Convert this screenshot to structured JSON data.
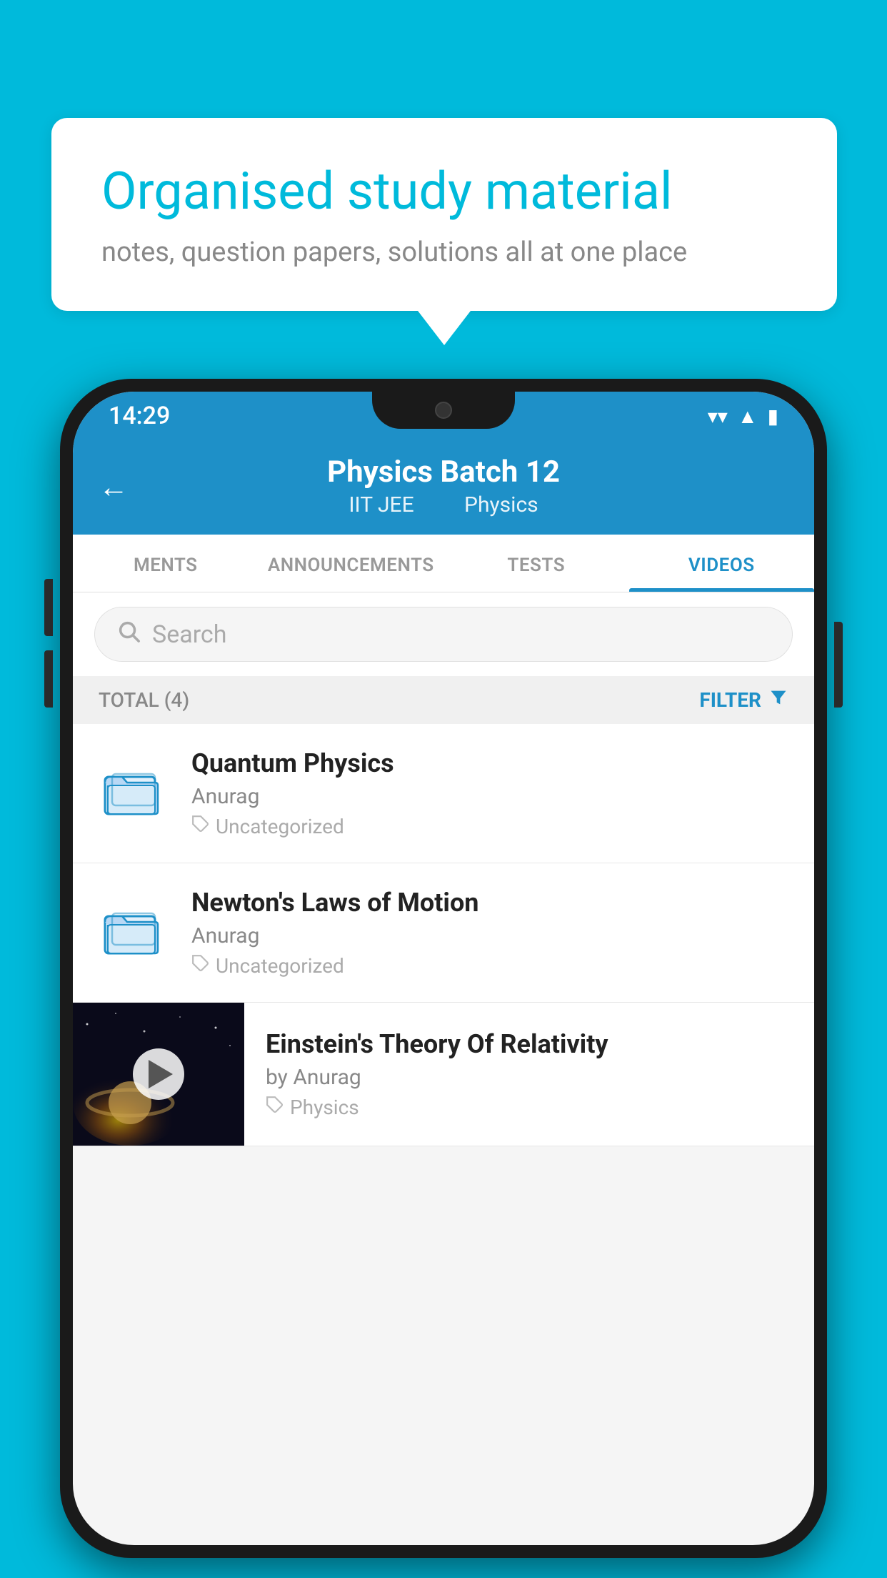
{
  "background": {
    "color": "#00BADB"
  },
  "speech_bubble": {
    "title": "Organised study material",
    "subtitle": "notes, question papers, solutions all at one place"
  },
  "phone": {
    "status_bar": {
      "time": "14:29",
      "icons": [
        "wifi",
        "signal",
        "battery"
      ]
    },
    "header": {
      "back_label": "←",
      "title": "Physics Batch 12",
      "subtitle_part1": "IIT JEE",
      "subtitle_part2": "Physics"
    },
    "tabs": [
      {
        "label": "MENTS",
        "active": false
      },
      {
        "label": "ANNOUNCEMENTS",
        "active": false
      },
      {
        "label": "TESTS",
        "active": false
      },
      {
        "label": "VIDEOS",
        "active": true
      }
    ],
    "search": {
      "placeholder": "Search"
    },
    "filter_bar": {
      "total_label": "TOTAL (4)",
      "filter_label": "FILTER"
    },
    "videos": [
      {
        "title": "Quantum Physics",
        "author": "Anurag",
        "tag": "Uncategorized",
        "type": "folder"
      },
      {
        "title": "Newton's Laws of Motion",
        "author": "Anurag",
        "tag": "Uncategorized",
        "type": "folder"
      },
      {
        "title": "Einstein's Theory Of Relativity",
        "author": "by Anurag",
        "tag": "Physics",
        "type": "video"
      }
    ]
  }
}
